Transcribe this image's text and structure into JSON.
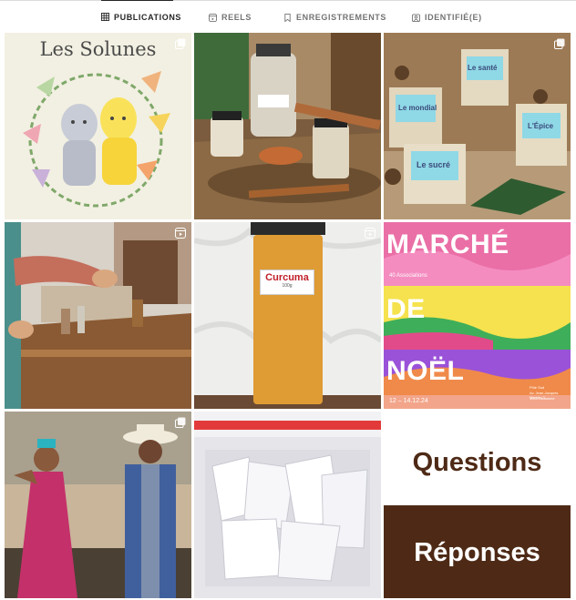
{
  "tabs": [
    {
      "label": "PUBLICATIONS",
      "icon": "grid-icon",
      "active": true
    },
    {
      "label": "REELS",
      "icon": "reels-icon",
      "active": false
    },
    {
      "label": "ENREGISTREMENTS",
      "icon": "bookmark-icon",
      "active": false
    },
    {
      "label": "IDENTIFIÉ(E)",
      "icon": "tagged-icon",
      "active": false
    }
  ],
  "posts": [
    {
      "type": "carousel",
      "title": "Les Solunes"
    },
    {
      "type": "image"
    },
    {
      "type": "carousel",
      "box_labels": [
        "Le santé",
        "Le mondial",
        "Le sucré",
        "L'Épice"
      ]
    },
    {
      "type": "reel"
    },
    {
      "type": "reel",
      "label": "Curcuma",
      "label_sub": "100g"
    },
    {
      "type": "image",
      "lines": [
        "MARCHÉ",
        "DE",
        "NOËL"
      ],
      "sub": "40 Associations",
      "dates": "12 – 14.12.24",
      "venue": [
        "Pôle Sud",
        "Av. Jean-Jacques Mercier 3",
        "1003 Lausanne"
      ]
    },
    {
      "type": "carousel"
    },
    {
      "type": "image"
    },
    {
      "type": "image",
      "question": "Questions",
      "answer": "Réponses"
    }
  ],
  "colors": {
    "accent_brown": "#4e2a16",
    "tab_active": "#262626",
    "tab_inactive": "#737373"
  }
}
